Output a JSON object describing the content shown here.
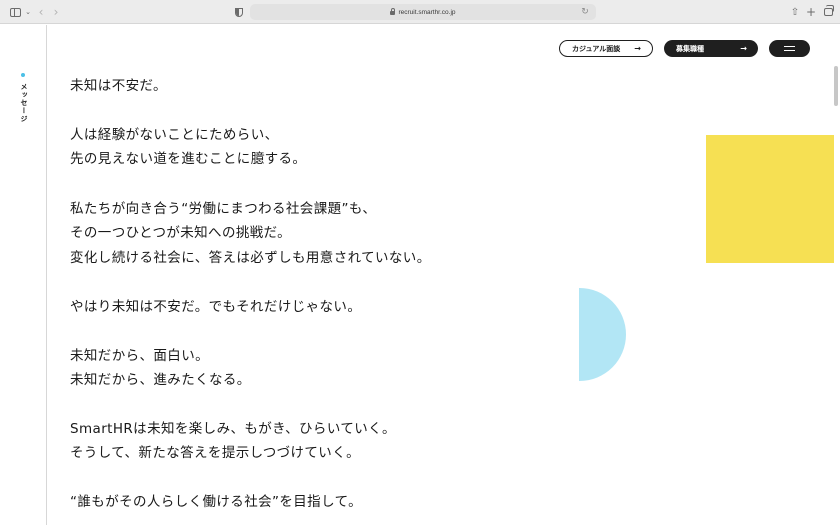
{
  "browser": {
    "url": "recruit.smarthr.co.jp",
    "icons": {
      "sidebar": "sidebar-icon",
      "back": "chevron-left-icon",
      "forward": "chevron-right-icon",
      "privacy": "shield-icon",
      "lock": "lock-icon",
      "reload": "reload-icon",
      "share": "share-icon",
      "new_tab": "plus-icon",
      "tab_overview": "tabs-icon"
    }
  },
  "rail": {
    "label": "メッセージ",
    "dot_color": "#4cc0e6"
  },
  "header": {
    "casual_label": "カジュアル面談",
    "recruit_label": "募集職種",
    "arrow": "→"
  },
  "decorations": {
    "yellow": "#f6e053",
    "cyan": "#b2e6f5"
  },
  "message": {
    "lines": [
      "未知は不安だ。",
      "人は経験がないことにためらい、",
      "先の見えない道を進むことに臆する。",
      "私たちが向き合う“労働にまつわる社会課題”も、",
      "その一つひとつが未知への挑戦だ。",
      "変化し続ける社会に、答えは必ずしも用意されていない。",
      "やはり未知は不安だ。でもそれだけじゃない。",
      "未知だから、面白い。",
      "未知だから、進みたくなる。",
      "SmartHRは未知を楽しみ、もがき、ひらいていく。",
      "そうして、新たな答えを提示しつづけていく。",
      "“誰もがその人らしく働ける社会”を目指して。"
    ]
  }
}
